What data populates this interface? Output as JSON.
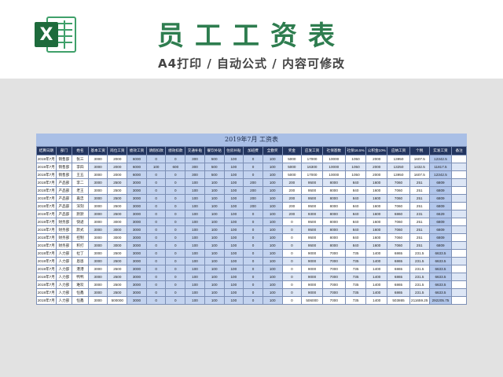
{
  "header": {
    "title": "员工工资表",
    "subtitle": "A4打印 / 自动公式 / 内容可修改",
    "logo_letter": "X",
    "colors": {
      "title": "#2e7d4f",
      "logo_dark": "#1e6b3c",
      "logo_light": "#3fa06a"
    }
  },
  "sheet": {
    "title": "2019年7月   工资表",
    "columns": [
      "结算日期",
      "部门",
      "姓名",
      "基本工资",
      "岗位工资",
      "绩效工资",
      "请假扣款",
      "绩效扣款",
      "交通补贴",
      "餐饮补贴",
      "住房补贴",
      "加班费",
      "全勤奖",
      "奖金",
      "应发工资",
      "社保基数",
      "社保16.5%",
      "公积金10%",
      "应纳工资",
      "个税",
      "实发工资",
      "备注"
    ],
    "rows": [
      [
        "2019年7月",
        "销售部",
        "张三",
        "3000",
        "2000",
        "6000",
        "0",
        "0",
        "300",
        "500",
        "100",
        "0",
        "100",
        "5000",
        "17000",
        "10000",
        "1050",
        "2000",
        "13950",
        "1607.5",
        "12342.5",
        ""
      ],
      [
        "2019年7月",
        "销售部",
        "李四",
        "3000",
        "2000",
        "6000",
        "100",
        "600",
        "300",
        "500",
        "100",
        "0",
        "100",
        "5000",
        "16300",
        "10000",
        "1050",
        "2000",
        "13250",
        "1432.5",
        "11817.5",
        ""
      ],
      [
        "2019年7月",
        "销售部",
        "王五",
        "3000",
        "2000",
        "6000",
        "0",
        "0",
        "300",
        "500",
        "100",
        "0",
        "100",
        "5000",
        "17000",
        "10000",
        "1050",
        "2000",
        "13950",
        "1607.5",
        "12342.5",
        ""
      ],
      [
        "2019年7月",
        "产品部",
        "李二",
        "3000",
        "2500",
        "3000",
        "0",
        "0",
        "100",
        "100",
        "100",
        "200",
        "100",
        "200",
        "9500",
        "8000",
        "840",
        "1600",
        "7060",
        "251",
        "6809",
        ""
      ],
      [
        "2019年7月",
        "产品部",
        "老王",
        "3000",
        "2500",
        "3000",
        "0",
        "0",
        "100",
        "100",
        "100",
        "200",
        "100",
        "200",
        "9500",
        "8000",
        "840",
        "1600",
        "7060",
        "251",
        "6809",
        ""
      ],
      [
        "2019年7月",
        "产品部",
        "嘉忠",
        "3000",
        "2500",
        "3000",
        "0",
        "0",
        "100",
        "100",
        "100",
        "200",
        "100",
        "200",
        "9500",
        "8000",
        "840",
        "1600",
        "7060",
        "251",
        "6809",
        ""
      ],
      [
        "2019年7月",
        "产品部",
        "深刻",
        "3000",
        "2500",
        "3000",
        "0",
        "0",
        "100",
        "100",
        "100",
        "200",
        "100",
        "200",
        "9500",
        "8000",
        "840",
        "1600",
        "7060",
        "251",
        "6809",
        ""
      ],
      [
        "2019年7月",
        "产品部",
        "默默",
        "3000",
        "2500",
        "3000",
        "0",
        "0",
        "100",
        "100",
        "100",
        "0",
        "100",
        "200",
        "9300",
        "8000",
        "840",
        "1600",
        "6860",
        "231",
        "6629",
        ""
      ],
      [
        "2019年7月",
        "财务部",
        "快递",
        "3000",
        "3000",
        "3000",
        "0",
        "0",
        "100",
        "100",
        "100",
        "0",
        "100",
        "0",
        "9500",
        "8000",
        "840",
        "1600",
        "7060",
        "251",
        "6809",
        ""
      ],
      [
        "2019年7月",
        "财务部",
        "默式",
        "3000",
        "3000",
        "3000",
        "0",
        "0",
        "100",
        "100",
        "100",
        "0",
        "100",
        "0",
        "9500",
        "8000",
        "840",
        "1600",
        "7060",
        "251",
        "6809",
        ""
      ],
      [
        "2019年7月",
        "财务部",
        "控制",
        "3000",
        "3000",
        "3000",
        "0",
        "0",
        "100",
        "100",
        "100",
        "0",
        "100",
        "0",
        "9500",
        "8000",
        "840",
        "1600",
        "7060",
        "251",
        "6809",
        ""
      ],
      [
        "2019年7月",
        "财务部",
        "积打",
        "3000",
        "3000",
        "3000",
        "0",
        "0",
        "100",
        "100",
        "100",
        "0",
        "100",
        "0",
        "9500",
        "8000",
        "840",
        "1600",
        "7060",
        "251",
        "6809",
        ""
      ],
      [
        "2019年7月",
        "人力部",
        "拉丁",
        "3000",
        "2500",
        "3000",
        "0",
        "0",
        "100",
        "100",
        "100",
        "0",
        "100",
        "0",
        "9000",
        "7000",
        "735",
        "1400",
        "6865",
        "231.5",
        "6633.5",
        ""
      ],
      [
        "2019年7月",
        "人力部",
        "恩恩",
        "3000",
        "2500",
        "3000",
        "0",
        "0",
        "100",
        "100",
        "100",
        "0",
        "100",
        "0",
        "9000",
        "7000",
        "735",
        "1400",
        "6865",
        "231.5",
        "6633.5",
        ""
      ],
      [
        "2019年7月",
        "人力部",
        "港港",
        "3000",
        "2500",
        "3000",
        "0",
        "0",
        "100",
        "100",
        "100",
        "0",
        "100",
        "0",
        "9000",
        "7000",
        "735",
        "1400",
        "6865",
        "231.5",
        "6633.5",
        ""
      ],
      [
        "2019年7月",
        "人力部",
        "鸭鸭",
        "3000",
        "2500",
        "3000",
        "0",
        "0",
        "100",
        "100",
        "100",
        "0",
        "100",
        "0",
        "9000",
        "7000",
        "735",
        "1400",
        "6865",
        "231.5",
        "6633.5",
        ""
      ],
      [
        "2019年7月",
        "人力部",
        "难欢",
        "3000",
        "2500",
        "3000",
        "0",
        "0",
        "100",
        "100",
        "100",
        "0",
        "100",
        "0",
        "9000",
        "7000",
        "735",
        "1400",
        "6865",
        "231.5",
        "6633.5",
        ""
      ],
      [
        "2019年7月",
        "人力部",
        "恒鑫",
        "3000",
        "2500",
        "3000",
        "0",
        "0",
        "100",
        "100",
        "100",
        "0",
        "100",
        "0",
        "9000",
        "7000",
        "735",
        "1400",
        "6865",
        "231.5",
        "6633.5",
        ""
      ],
      [
        "2019年7月",
        "人力部",
        "恒鑫",
        "3000",
        "500000",
        "3000",
        "0",
        "0",
        "100",
        "100",
        "100",
        "0",
        "100",
        "0",
        "506000",
        "7000",
        "735",
        "1400",
        "503865",
        "211659.25",
        "292205.75",
        ""
      ]
    ]
  }
}
